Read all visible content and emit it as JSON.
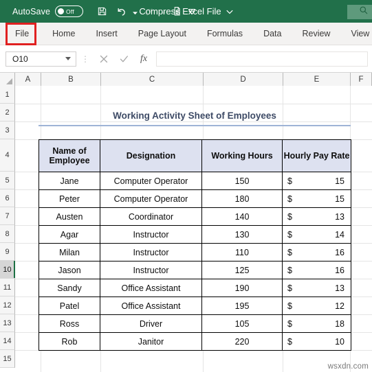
{
  "titlebar": {
    "autosave_label": "AutoSave",
    "autosave_state": "Off",
    "document_title": "Compress Excel File",
    "quick_access": [
      {
        "name": "save-icon",
        "label": "Save"
      },
      {
        "name": "undo-icon",
        "label": "Undo"
      },
      {
        "name": "redo-icon",
        "label": "Redo"
      },
      {
        "name": "print-preview-icon",
        "label": "Print Preview and Print"
      },
      {
        "name": "customize-quick-access-toolbar-icon",
        "label": "Customize Quick Access Toolbar"
      }
    ],
    "search_icon": "search-icon",
    "title_dropdown_icon": "chevron-down-icon",
    "bar_color": "#21704a"
  },
  "ribbon": {
    "tabs": [
      {
        "label": "File",
        "active": false,
        "highlighted": true
      },
      {
        "label": "Home",
        "active": false,
        "highlighted": false
      },
      {
        "label": "Insert",
        "active": false,
        "highlighted": false
      },
      {
        "label": "Page Layout",
        "active": false,
        "highlighted": false
      },
      {
        "label": "Formulas",
        "active": false,
        "highlighted": false
      },
      {
        "label": "Data",
        "active": false,
        "highlighted": false
      },
      {
        "label": "Review",
        "active": false,
        "highlighted": false
      },
      {
        "label": "View",
        "active": false,
        "highlighted": false
      }
    ],
    "highlight_color": "#e02020"
  },
  "formula_bar": {
    "name_box_value": "O10",
    "name_box_caret": "chevron-down-icon",
    "cancel_icon": "close-icon",
    "enter_icon": "check-icon",
    "insert_function_icon": "fx-icon",
    "insert_function_label": "fx",
    "formula_value": "",
    "formula_placeholder": ""
  },
  "grid": {
    "columns": [
      "A",
      "B",
      "C",
      "D",
      "E",
      "F"
    ],
    "rows": [
      "1",
      "2",
      "3",
      "4",
      "5",
      "6",
      "7",
      "8",
      "9",
      "10",
      "11",
      "12",
      "13",
      "14",
      "15"
    ],
    "selected_row": "10",
    "selected_cell": "O10"
  },
  "sheet": {
    "report_title": "Working Activity Sheet of Employees",
    "title_accent_color": "#9eb3d6",
    "header_fill_color": "#dde1f0",
    "headers": [
      "Name of Employee",
      "Designation",
      "Working Hours",
      "Hourly Pay Rate"
    ],
    "currency_symbol": "$",
    "rows": [
      {
        "name": "Jane",
        "designation": "Computer Operator",
        "hours": "150",
        "rate": "15"
      },
      {
        "name": "Peter",
        "designation": "Computer Operator",
        "hours": "180",
        "rate": "15"
      },
      {
        "name": "Austen",
        "designation": "Coordinator",
        "hours": "140",
        "rate": "13"
      },
      {
        "name": "Agar",
        "designation": "Instructor",
        "hours": "130",
        "rate": "14"
      },
      {
        "name": "Milan",
        "designation": "Instructor",
        "hours": "110",
        "rate": "16"
      },
      {
        "name": "Jason",
        "designation": "Instructor",
        "hours": "125",
        "rate": "16"
      },
      {
        "name": "Sandy",
        "designation": "Office Assistant",
        "hours": "190",
        "rate": "13"
      },
      {
        "name": "Patel",
        "designation": "Office Assistant",
        "hours": "195",
        "rate": "12"
      },
      {
        "name": "Ross",
        "designation": "Driver",
        "hours": "105",
        "rate": "18"
      },
      {
        "name": "Rob",
        "designation": "Janitor",
        "hours": "220",
        "rate": "10"
      }
    ]
  },
  "watermark": "wsxdn.com"
}
